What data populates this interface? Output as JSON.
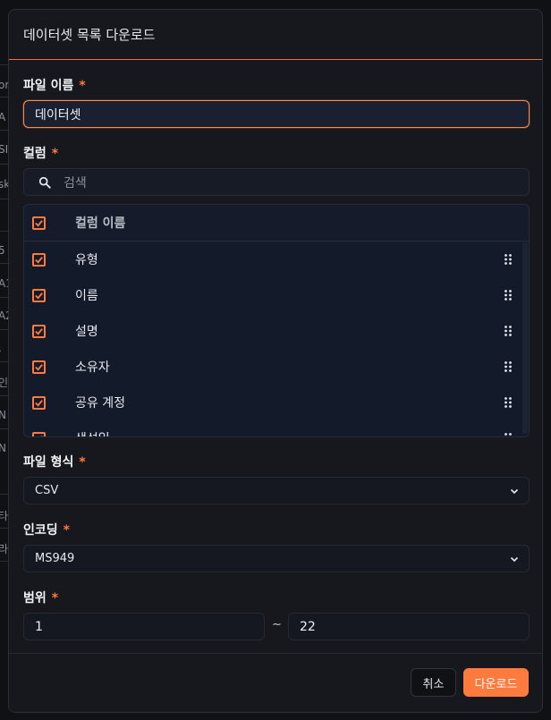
{
  "background": {
    "left_edge_text": [
      "on",
      "A",
      "SI",
      "sk",
      "5",
      "A1",
      "A2",
      ",",
      "인",
      "N",
      "N",
      "타",
      "라"
    ]
  },
  "dialog": {
    "title": "데이터셋 목록 다운로드",
    "required_mark": "*",
    "file_name": {
      "label": "파일 이름",
      "value": "데이터셋"
    },
    "columns": {
      "label": "컬럼",
      "search_placeholder": "검색",
      "header_label": "컬럼 이름",
      "items": [
        {
          "label": "유형",
          "checked": true
        },
        {
          "label": "이름",
          "checked": true
        },
        {
          "label": "설명",
          "checked": true
        },
        {
          "label": "소유자",
          "checked": true
        },
        {
          "label": "공유 계정",
          "checked": true
        },
        {
          "label": "생성일",
          "checked": true
        }
      ]
    },
    "file_format": {
      "label": "파일 형식",
      "value": "CSV"
    },
    "encoding": {
      "label": "인코딩",
      "value": "MS949"
    },
    "range": {
      "label": "범위",
      "from": "1",
      "separator": "~",
      "to": "22"
    },
    "buttons": {
      "cancel": "취소",
      "download": "다운로드"
    }
  },
  "colors": {
    "accent": "#ff7a3d",
    "modal_bg": "#16181d",
    "list_bg": "#131a2a"
  }
}
